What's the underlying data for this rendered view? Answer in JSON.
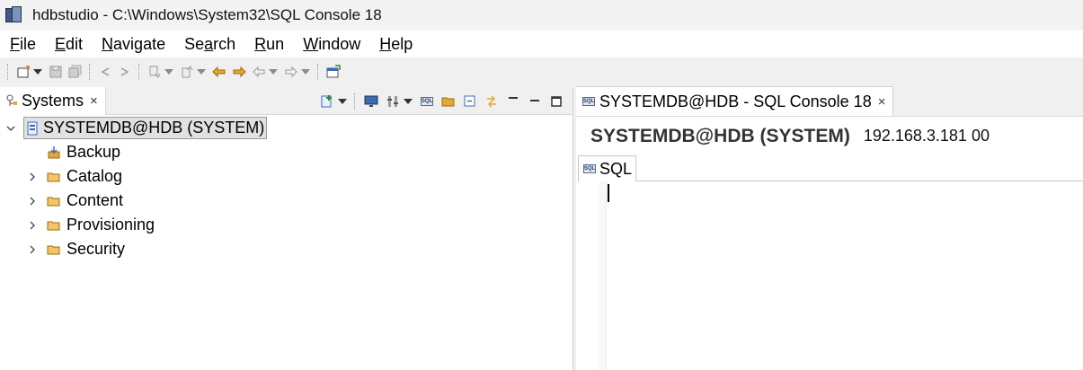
{
  "window": {
    "title": "hdbstudio - C:\\Windows\\System32\\SQL Console 18"
  },
  "menu": {
    "items": [
      {
        "mnemonic": "F",
        "rest": "ile"
      },
      {
        "mnemonic": "E",
        "rest": "dit"
      },
      {
        "mnemonic": "N",
        "rest": "avigate"
      },
      {
        "mnemonic": "",
        "pre": "Se",
        "under": "a",
        "rest": "rch"
      },
      {
        "mnemonic": "R",
        "rest": "un"
      },
      {
        "mnemonic": "W",
        "rest": "indow"
      },
      {
        "mnemonic": "H",
        "rest": "elp"
      }
    ],
    "labels": [
      "File",
      "Edit",
      "Navigate",
      "Search",
      "Run",
      "Window",
      "Help"
    ]
  },
  "systems_view": {
    "tab_label": "Systems",
    "close_glyph": "×",
    "tree": {
      "root": {
        "label": "SYSTEMDB@HDB (SYSTEM)",
        "expanded": true
      },
      "children": [
        {
          "label": "Backup",
          "expandable": false,
          "icon": "backup-icon"
        },
        {
          "label": "Catalog",
          "expandable": true,
          "icon": "folder-icon"
        },
        {
          "label": "Content",
          "expandable": true,
          "icon": "folder-icon"
        },
        {
          "label": "Provisioning",
          "expandable": true,
          "icon": "folder-icon"
        },
        {
          "label": "Security",
          "expandable": true,
          "icon": "folder-icon"
        }
      ]
    }
  },
  "console": {
    "tab_label": "SYSTEMDB@HDB - SQL Console 18",
    "close_glyph": "×",
    "connection_title": "SYSTEMDB@HDB (SYSTEM)",
    "connection_host": "192.168.3.181 00",
    "sql_tab_label": "SQL",
    "sql_icon_text": "SQL"
  },
  "colors": {
    "folder": "#e3a83a",
    "accent_blue": "#3b6bb5",
    "selection_bg": "#e1e1e1"
  }
}
